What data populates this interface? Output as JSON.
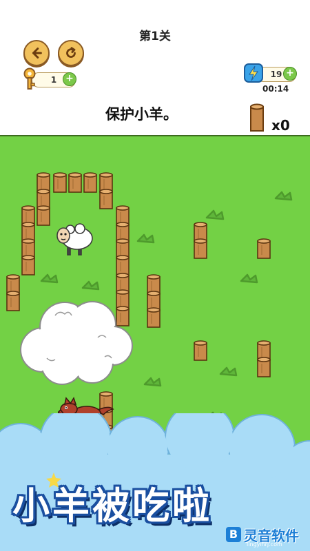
{
  "header": {
    "level_title": "第1关",
    "back_icon": "arrow-left-icon",
    "restart_icon": "restart-icon",
    "key_count": "1",
    "energy_count": "19",
    "timer": "00:14",
    "instruction": "保护小羊。",
    "stake_count": "x0"
  },
  "banner": {
    "text": "小羊被吃啦"
  },
  "watermark": {
    "text": "灵音软件",
    "logo_letter": "B",
    "url": "lingyinrj.com"
  },
  "colors": {
    "grass": "#73d145",
    "banner_cloud": "#a9dcf7",
    "button_fill": "#f1c15d",
    "plus_green": "#7cc84a"
  }
}
